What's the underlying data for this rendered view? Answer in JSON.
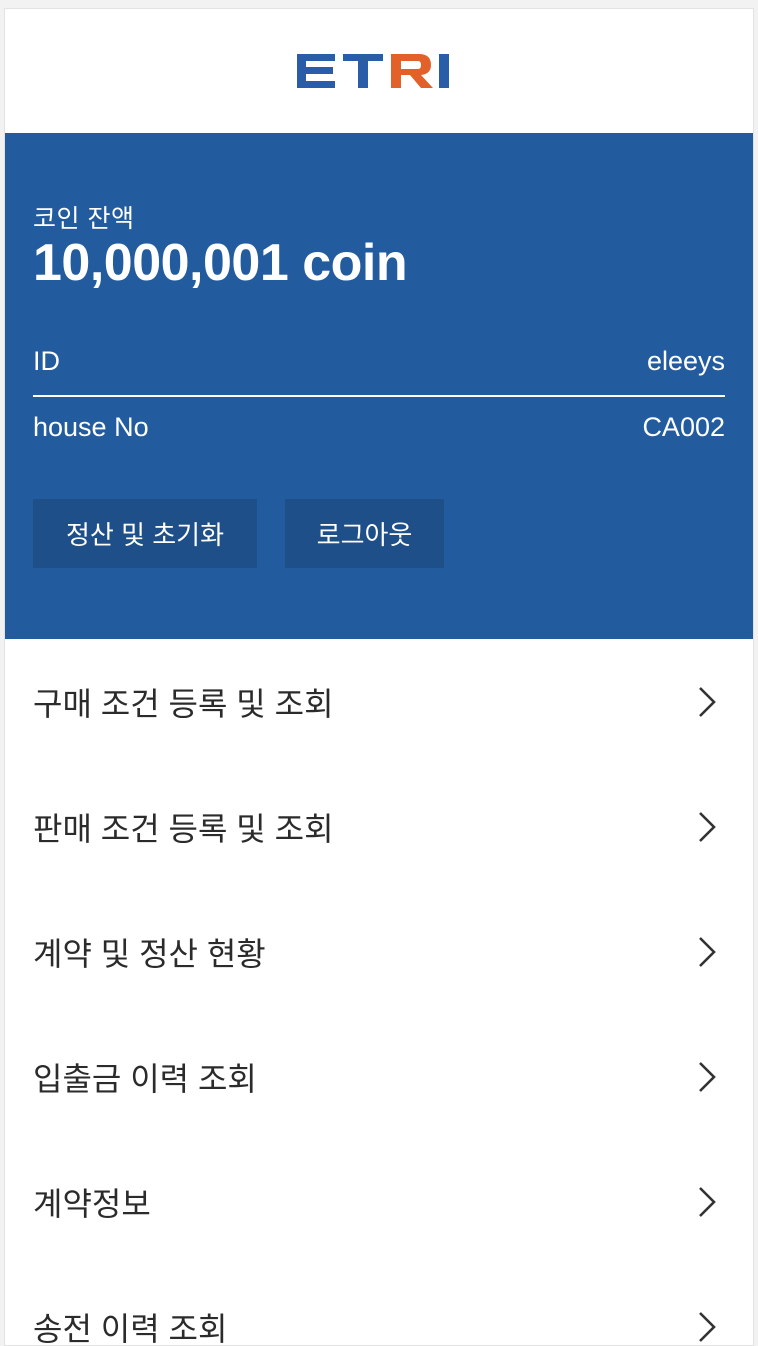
{
  "header": {
    "logo_text": "ETRI",
    "logo_colors": {
      "primary": "#2a5da8",
      "accent": "#e2612a"
    }
  },
  "account": {
    "balance_label": "코인 잔액",
    "balance_value": "10,000,001 coin",
    "id_label": "ID",
    "id_value": "eleeys",
    "house_label": "house No",
    "house_value": "CA002"
  },
  "actions": {
    "reset_label": "정산 및 초기화",
    "logout_label": "로그아웃"
  },
  "menu": {
    "items": [
      {
        "label": "구매 조건 등록 및 조회",
        "icon": "chevron-right-icon"
      },
      {
        "label": "판매 조건 등록 및 조회",
        "icon": "chevron-right-icon"
      },
      {
        "label": "계약 및 정산 현황",
        "icon": "chevron-right-icon"
      },
      {
        "label": "입출금 이력 조회",
        "icon": "chevron-right-icon"
      },
      {
        "label": "계약정보",
        "icon": "chevron-right-icon"
      },
      {
        "label": "송전 이력 조회",
        "icon": "chevron-right-icon"
      }
    ]
  },
  "colors": {
    "hero_bg": "#235c9e",
    "button_bg": "#1e4f88",
    "text_dark": "#2b2b2b"
  }
}
